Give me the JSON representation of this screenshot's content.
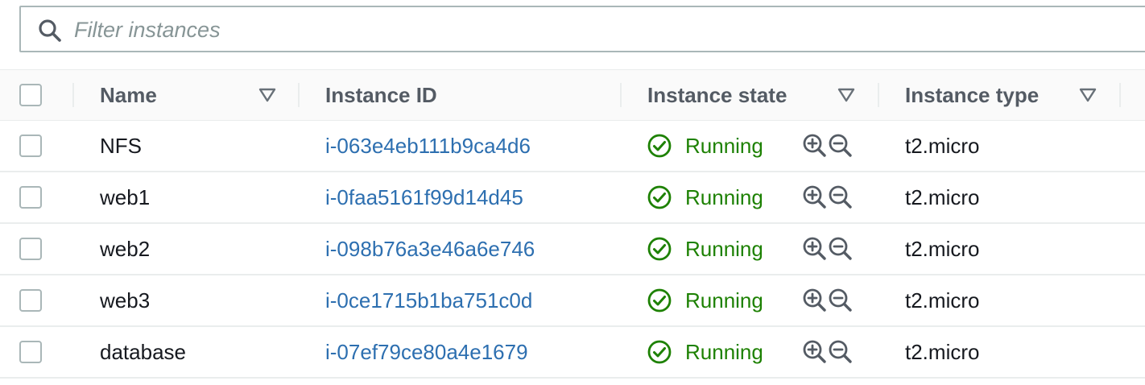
{
  "filter": {
    "placeholder": "Filter instances",
    "value": "",
    "icon": "search-icon"
  },
  "table": {
    "columns": [
      {
        "label": "Name",
        "sortable": true
      },
      {
        "label": "Instance ID",
        "sortable": false
      },
      {
        "label": "Instance state",
        "sortable": true
      },
      {
        "label": "Instance type",
        "sortable": true
      }
    ],
    "rows": [
      {
        "name": "NFS",
        "instance_id": "i-063e4eb111b9ca4d6",
        "state": "Running",
        "type": "t2.micro"
      },
      {
        "name": "web1",
        "instance_id": "i-0faa5161f99d14d45",
        "state": "Running",
        "type": "t2.micro"
      },
      {
        "name": "web2",
        "instance_id": "i-098b76a3e46a6e746",
        "state": "Running",
        "type": "t2.micro"
      },
      {
        "name": "web3",
        "instance_id": "i-0ce1715b1ba751c0d",
        "state": "Running",
        "type": "t2.micro"
      },
      {
        "name": "database",
        "instance_id": "i-07ef79ce80a4e1679",
        "state": "Running",
        "type": "t2.micro"
      }
    ]
  },
  "colors": {
    "link": "#2d6fb0",
    "status_running": "#1d8102",
    "header_text": "#545b64",
    "border": "#aab7b8"
  }
}
